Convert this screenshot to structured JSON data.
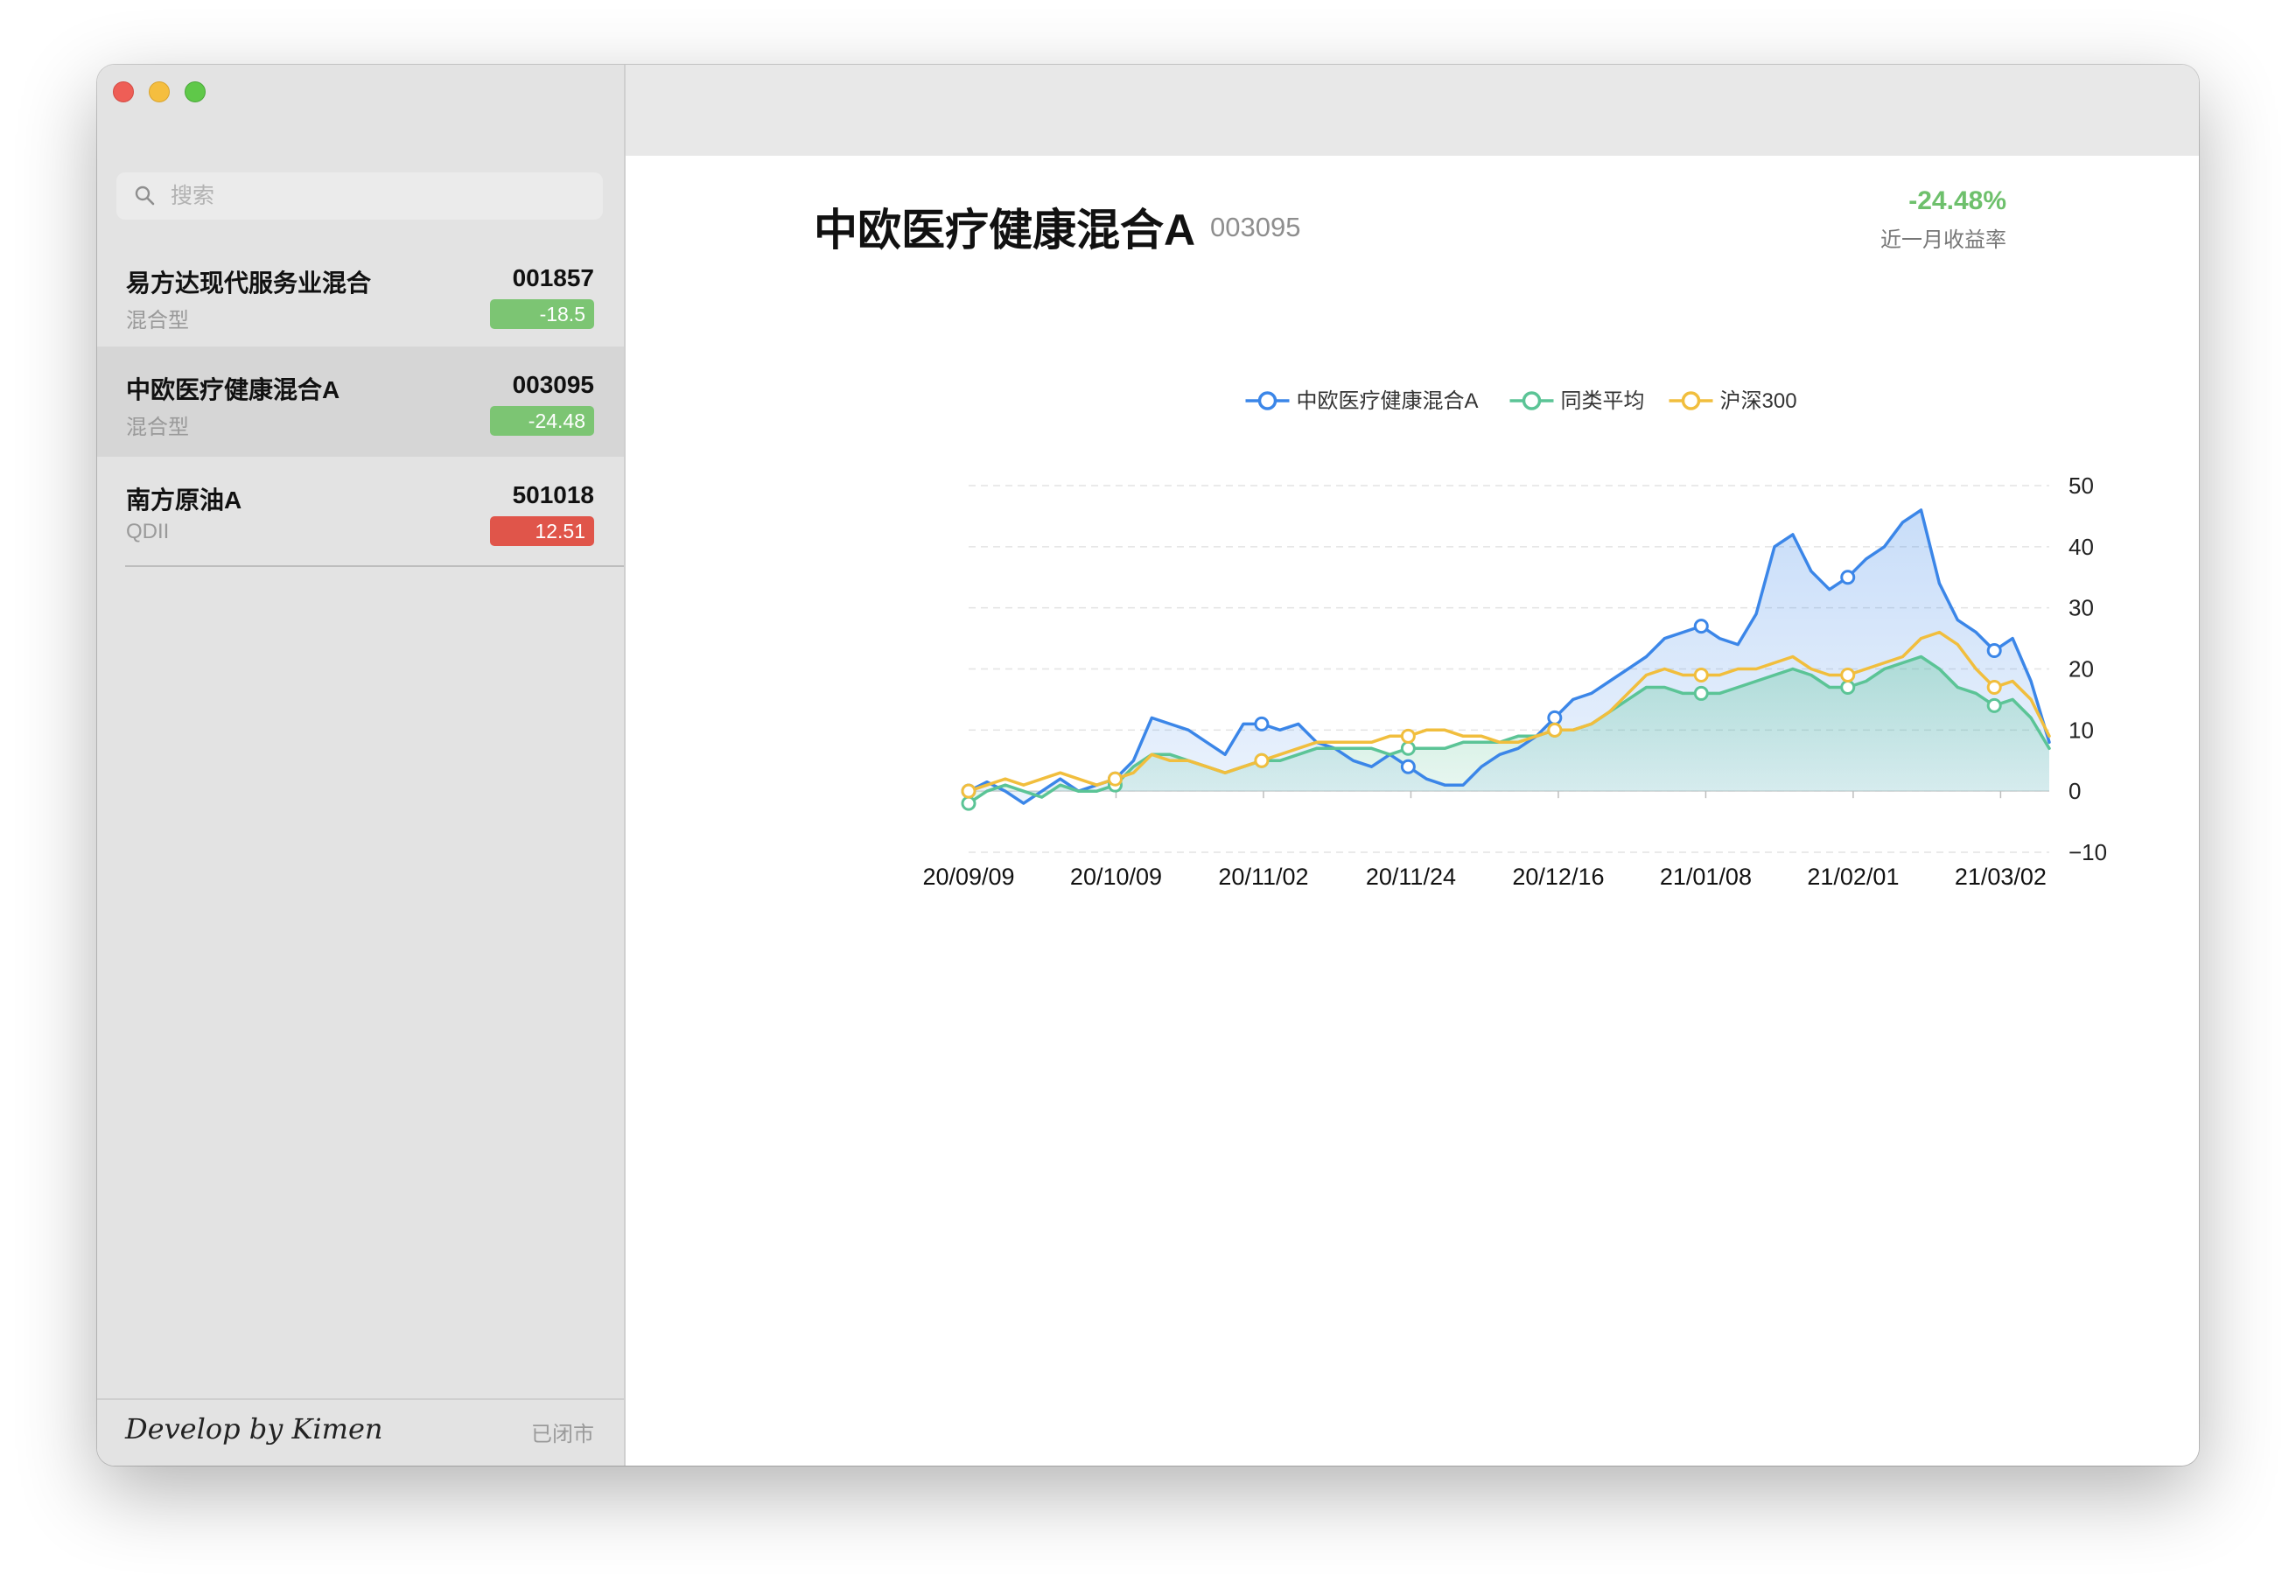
{
  "sidebar": {
    "search": {
      "placeholder": "搜索"
    },
    "funds": [
      {
        "name": "易方达现代服务业混合",
        "code": "001857",
        "type": "混合型",
        "change": "-18.5",
        "change_color": "#7cc573"
      },
      {
        "name": "中欧医疗健康混合A",
        "code": "003095",
        "type": "混合型",
        "change": "-24.48",
        "change_color": "#7cc573"
      },
      {
        "name": "南方原油A",
        "code": "501018",
        "type": "QDII",
        "change": "12.51",
        "change_color": "#e0554a"
      }
    ],
    "footer": {
      "credit": "Develop by Kimen",
      "status": "已闭市"
    }
  },
  "main": {
    "title": "中欧医疗健康混合A",
    "code": "003095",
    "yield": "-24.48%",
    "yield_label": "近一月收益率"
  },
  "chart_data": {
    "type": "line",
    "x_ticks": [
      "20/09/09",
      "20/10/09",
      "20/11/02",
      "20/11/24",
      "20/12/16",
      "21/01/08",
      "21/02/01",
      "21/03/02"
    ],
    "y_ticks": [
      50,
      40,
      30,
      20,
      10,
      0,
      -10
    ],
    "ylim": [
      -10,
      50
    ],
    "grid": true,
    "legend_position": "top-center",
    "series": [
      {
        "name": "中欧医疗健康混合A",
        "color": "#3b86e8",
        "values": [
          0,
          1.5,
          0,
          -2,
          0,
          2,
          0,
          1,
          2,
          5,
          12,
          11,
          10,
          8,
          6,
          11,
          11,
          10,
          11,
          8,
          7,
          5,
          4,
          6,
          4,
          2,
          1,
          1,
          4,
          6,
          7,
          9,
          12,
          15,
          16,
          18,
          20,
          22,
          25,
          26,
          27,
          25,
          24,
          29,
          40,
          42,
          36,
          33,
          35,
          38,
          40,
          44,
          46,
          34,
          28,
          26,
          23,
          25,
          18,
          8
        ]
      },
      {
        "name": "同类平均",
        "color": "#5bc496",
        "values": [
          -2,
          0,
          1,
          0,
          -1,
          1,
          0,
          0,
          1,
          4,
          6,
          6,
          5,
          4,
          3,
          4,
          5,
          5,
          6,
          7,
          7,
          7,
          7,
          6,
          7,
          7,
          7,
          8,
          8,
          8,
          9,
          9,
          10,
          10,
          11,
          13,
          15,
          17,
          17,
          16,
          16,
          16,
          17,
          18,
          19,
          20,
          19,
          17,
          17,
          18,
          20,
          21,
          22,
          20,
          17,
          16,
          14,
          15,
          12,
          7
        ]
      },
      {
        "name": "沪深300",
        "color": "#f1be3d",
        "values": [
          0,
          1,
          2,
          1,
          2,
          3,
          2,
          1,
          2,
          3,
          6,
          5,
          5,
          4,
          3,
          4,
          5,
          6,
          7,
          8,
          8,
          8,
          8,
          9,
          9,
          10,
          10,
          9,
          9,
          8,
          8,
          9,
          10,
          10,
          11,
          13,
          16,
          19,
          20,
          19,
          19,
          19,
          20,
          20,
          21,
          22,
          20,
          19,
          19,
          20,
          21,
          22,
          25,
          26,
          24,
          20,
          17,
          18,
          15,
          9
        ]
      }
    ]
  }
}
